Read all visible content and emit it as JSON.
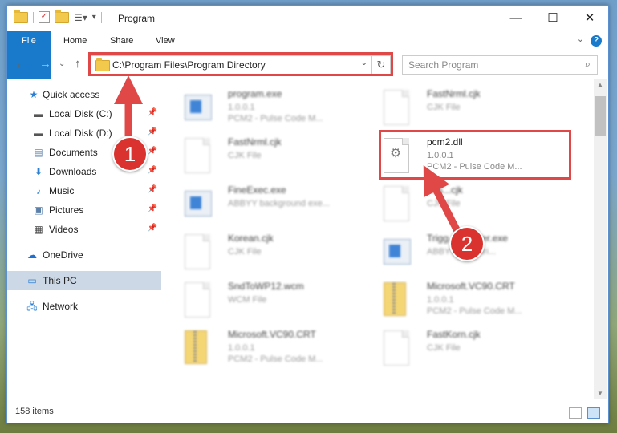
{
  "window": {
    "title": "Program"
  },
  "titlebar": {
    "minimize": "—",
    "maximize": "☐",
    "close": "✕"
  },
  "ribbon": {
    "tabs": [
      "File",
      "Home",
      "Share",
      "View"
    ],
    "help": "?"
  },
  "address": {
    "path": "C:\\Program Files\\Program Directory"
  },
  "search": {
    "placeholder": "Search Program"
  },
  "sidebar": {
    "items": [
      {
        "label": "Quick access",
        "icon": "star-icon"
      },
      {
        "label": "Local Disk (C:)",
        "icon": "drive-icon"
      },
      {
        "label": "Local Disk (D:)",
        "icon": "drive-icon"
      },
      {
        "label": "Documents",
        "icon": "documents-icon"
      },
      {
        "label": "Downloads",
        "icon": "download-icon"
      },
      {
        "label": "Music",
        "icon": "music-icon"
      },
      {
        "label": "Pictures",
        "icon": "pictures-icon"
      },
      {
        "label": "Videos",
        "icon": "videos-icon"
      },
      {
        "label": "OneDrive",
        "icon": "cloud-icon"
      },
      {
        "label": "This PC",
        "icon": "computer-icon"
      },
      {
        "label": "Network",
        "icon": "network-icon"
      }
    ]
  },
  "files": [
    {
      "name": "program.exe",
      "line1": "1.0.0.1",
      "line2": "PCM2 - Pulse Code M...",
      "icon": "app-gear"
    },
    {
      "name": "FastNrml.cjk",
      "line1": "CJK File",
      "line2": "",
      "icon": "doc"
    },
    {
      "name": "FastNrml.cjk",
      "line1": "CJK File",
      "line2": "",
      "icon": "doc"
    },
    {
      "name": "pcm2.dll",
      "line1": "1.0.0.1",
      "line2": "PCM2 - Pulse Code M...",
      "icon": "dll-gear"
    },
    {
      "name": "FineExec.exe",
      "line1": "ABBYY background exe...",
      "line2": "",
      "icon": "app"
    },
    {
      "name": "Fas...cjk",
      "line1": "CJK File",
      "line2": "",
      "icon": "doc"
    },
    {
      "name": "Korean.cjk",
      "line1": "CJK File",
      "line2": "",
      "icon": "doc"
    },
    {
      "name": "Trigg...Installer.exe",
      "line1": "ABBYY ...der tri...",
      "line2": "",
      "icon": "app"
    },
    {
      "name": "SndToWP12.wcm",
      "line1": "WCM File",
      "line2": "",
      "icon": "doc"
    },
    {
      "name": "Microsoft.VC90.CRT",
      "line1": "1.0.0.1",
      "line2": "PCM2 - Pulse Code M...",
      "icon": "zip"
    },
    {
      "name": "Microsoft.VC90.CRT",
      "line1": "1.0.0.1",
      "line2": "PCM2 - Pulse Code M...",
      "icon": "zip"
    },
    {
      "name": "FastKorn.cjk",
      "line1": "CJK File",
      "line2": "",
      "icon": "doc"
    }
  ],
  "status": {
    "count": "158 items"
  },
  "annotations": {
    "step1": "1",
    "step2": "2",
    "highlight_color": "#e04848",
    "badge_color": "#d9322f"
  }
}
